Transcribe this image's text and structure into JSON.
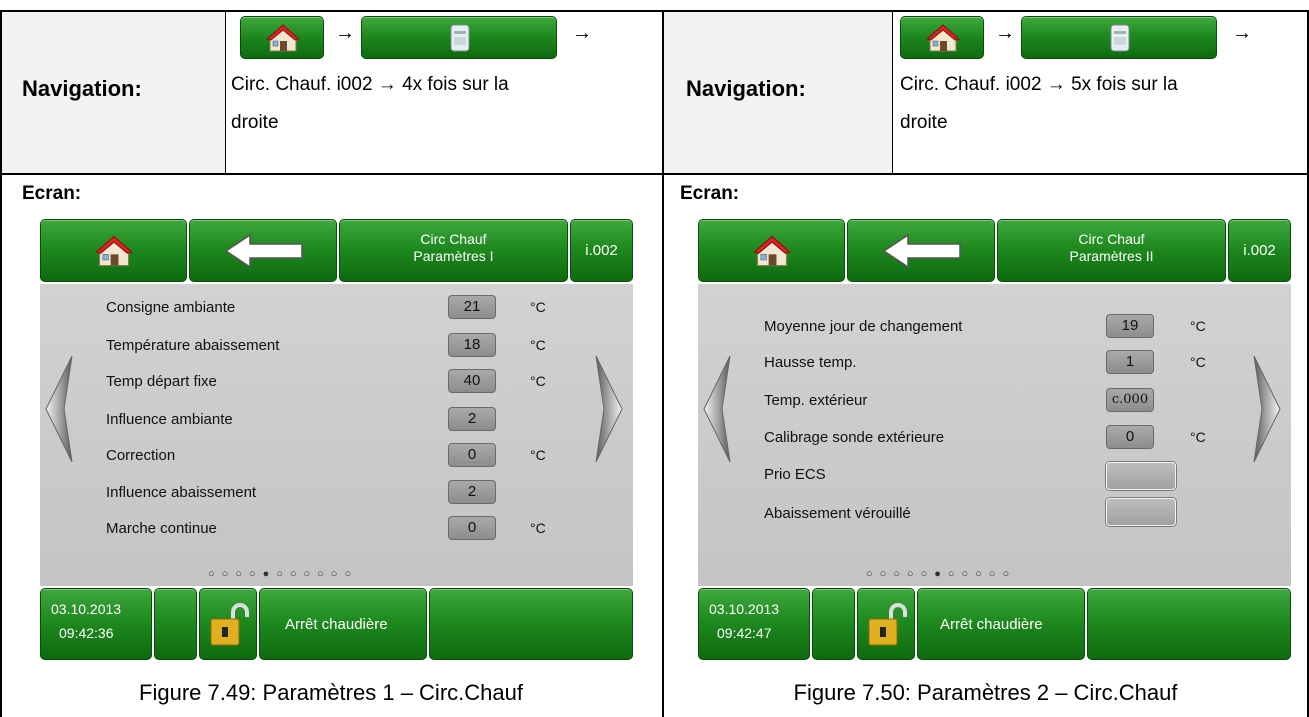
{
  "table": {
    "left": {
      "nav_label": "Navigation:",
      "nav_path_line1": "Circ. Chauf. i002 → 4x fois sur la",
      "nav_path_line2": "droite",
      "arrow": "→",
      "ecran_label": "Ecran:",
      "caption": "Figure 7.49: Paramètres 1 – Circ.Chauf",
      "screen": {
        "title_line1": "Circ Chauf",
        "title_line2": "Paramètres I",
        "id": "i.002",
        "rows": [
          {
            "label": "Consigne ambiante",
            "value": "21",
            "unit": "°C"
          },
          {
            "label": "Température abaissement",
            "value": "18",
            "unit": "°C"
          },
          {
            "label": "Temp départ fixe",
            "value": "40",
            "unit": "°C"
          },
          {
            "label": "Influence ambiante",
            "value": "2",
            "unit": ""
          },
          {
            "label": "Correction",
            "value": "0",
            "unit": "°C"
          },
          {
            "label": "Influence abaissement",
            "value": "2",
            "unit": ""
          },
          {
            "label": "Marche continue",
            "value": "0",
            "unit": "°C"
          }
        ],
        "page_dots": "○○○○●○○○○○○",
        "date": "03.10.2013",
        "time": "09:42:36",
        "status": "Arrêt chaudière"
      }
    },
    "right": {
      "nav_label": "Navigation:",
      "nav_path_line1": "Circ. Chauf. i002 → 5x fois sur la",
      "nav_path_line2": "droite",
      "arrow": "→",
      "ecran_label": "Ecran:",
      "caption": "Figure 7.50: Paramètres 2 – Circ.Chauf",
      "screen": {
        "title_line1": "Circ Chauf",
        "title_line2": "Paramètres II",
        "id": "i.002",
        "rows": [
          {
            "label": "Moyenne jour de changement",
            "value": "19",
            "unit": "°C"
          },
          {
            "label": "Hausse temp.",
            "value": "1",
            "unit": "°C"
          },
          {
            "label": "Temp. extérieur",
            "value": "c.000",
            "unit": ""
          },
          {
            "label": "Calibrage sonde extérieure",
            "value": "0",
            "unit": "°C"
          },
          {
            "label": "Prio ECS",
            "value": "",
            "unit": ""
          },
          {
            "label": "Abaissement vérouillé",
            "value": "",
            "unit": ""
          }
        ],
        "page_dots": "○○○○○●○○○○○",
        "date": "03.10.2013",
        "time": "09:42:47",
        "status": "Arrêt chaudière"
      }
    }
  },
  "icons": {
    "home": "home-icon",
    "back": "back-arrow-icon",
    "boiler": "boiler-icon",
    "lock": "unlocked-padlock-icon",
    "prev": "chevron-left-icon",
    "next": "chevron-right-icon"
  },
  "colors": {
    "green": "#1f8a1f",
    "panel_gray": "#c9c9c9",
    "cell_gray": "#f2f2f2"
  }
}
